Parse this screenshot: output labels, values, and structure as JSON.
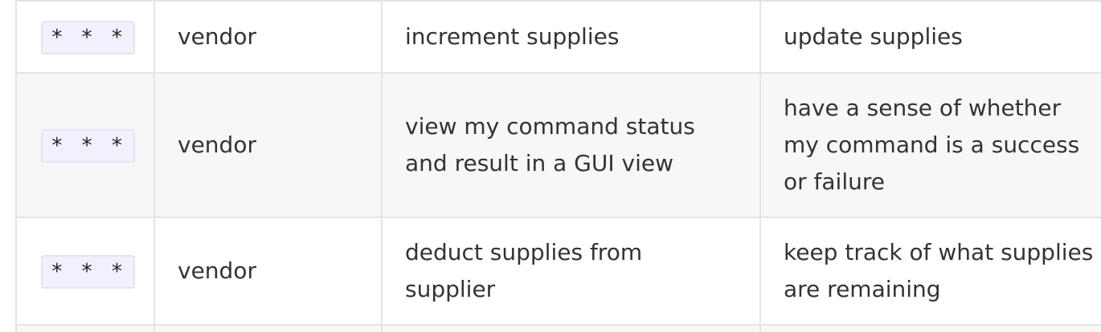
{
  "rows": [
    {
      "priority": "* * *",
      "as_a": "vendor",
      "i_want_to": "increment supplies",
      "so_that": "update supplies"
    },
    {
      "priority": "* * *",
      "as_a": "vendor",
      "i_want_to": "view my command status and result in a GUI view",
      "so_that": "have a sense of whether my command is a success or failure"
    },
    {
      "priority": "* * *",
      "as_a": "vendor",
      "i_want_to": "deduct supplies from supplier",
      "so_that": "keep track of what supplies are remaining"
    }
  ]
}
